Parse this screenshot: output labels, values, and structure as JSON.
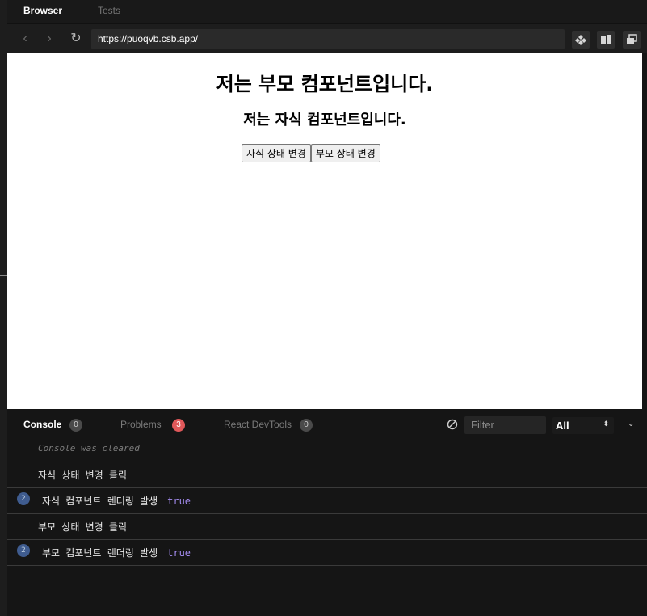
{
  "top_tabs": {
    "browser": "Browser",
    "tests": "Tests"
  },
  "address_bar": {
    "url": "https://puoqvb.csb.app/",
    "back_icon": "‹",
    "forward_icon": "›",
    "reload_icon": "↻"
  },
  "page": {
    "parent_heading": "저는 부모 컴포넌트입니다.",
    "child_heading": "저는 자식 컴포넌트입니다.",
    "child_button": "자식 상태 변경",
    "parent_button": "부모 상태 변경"
  },
  "console_panel": {
    "tabs": [
      {
        "label": "Console",
        "count": "0"
      },
      {
        "label": "Problems",
        "count": "3"
      },
      {
        "label": "React DevTools",
        "count": "0"
      }
    ],
    "filter_placeholder": "Filter",
    "level": "All",
    "level_arrow": "⬍",
    "collapse_icon": "⌄",
    "entries": [
      {
        "text": "Console was cleared",
        "count": "",
        "value": ""
      },
      {
        "text": "자식 상태 변경 클릭",
        "count": "",
        "value": ""
      },
      {
        "text": "자식 컴포넌트 렌더링 발생",
        "count": "2",
        "value": "true"
      },
      {
        "text": "부모 상태 변경 클릭",
        "count": "",
        "value": ""
      },
      {
        "text": "부모 컴포넌트 렌더링 발생",
        "count": "2",
        "value": "true"
      }
    ]
  },
  "colors": {
    "badge_red": "#e0585a",
    "value_purple": "#a48cf0",
    "count_blue": "#3f5c8f"
  }
}
